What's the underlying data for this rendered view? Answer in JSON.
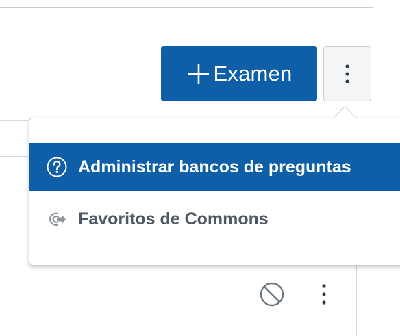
{
  "toolbar": {
    "add_quiz_label": "Examen",
    "add_quiz_icon": "plus-icon",
    "more_options_icon": "kebab-vertical-icon",
    "accent_color": "#0e5fa8"
  },
  "menu": {
    "items": [
      {
        "label": "Administrar bancos de preguntas",
        "icon": "question-circle-icon",
        "active": true
      },
      {
        "label": "Favoritos de Commons",
        "icon": "commons-icon",
        "active": false
      }
    ]
  },
  "row": {
    "icons": [
      "unpublished-icon",
      "kebab-vertical-icon"
    ]
  }
}
